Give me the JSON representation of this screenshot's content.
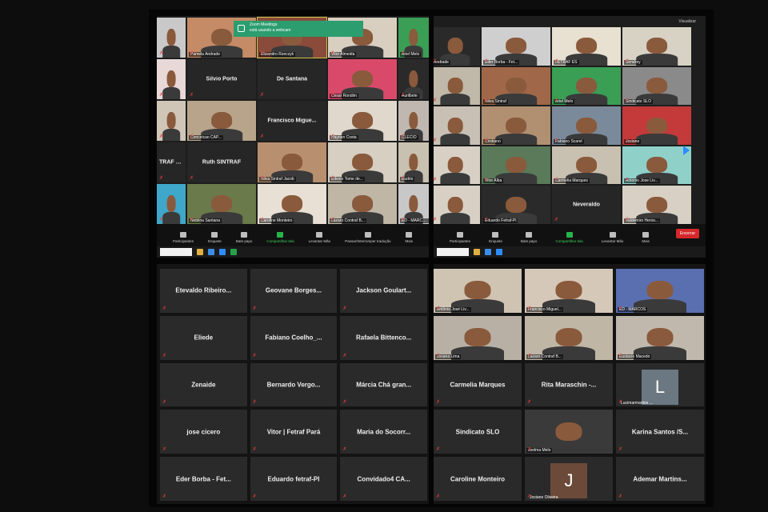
{
  "notification": {
    "title": "Zoom Meetings",
    "text": "está usando a webcam"
  },
  "view_button": "Visualizar",
  "tl": {
    "tiles": [
      {
        "t": "vid",
        "name": "",
        "c": "#c9c9c9"
      },
      {
        "t": "vid",
        "name": "Pamela Andrade",
        "c": "#c48b66"
      },
      {
        "t": "vid",
        "name": "Elizandro Rzeczyk",
        "c": "#8a4b3a",
        "hl": true
      },
      {
        "t": "vid",
        "name": "Vitor Almeida",
        "c": "#d8cfc0"
      },
      {
        "t": "vid",
        "name": "Ariel Melo",
        "c": "#3a9e55"
      },
      {
        "t": "vid",
        "name": "",
        "c": "#e8d8d8"
      },
      {
        "t": "name",
        "name": "Silvio Porto"
      },
      {
        "t": "name",
        "name": "De Santana"
      },
      {
        "t": "vid",
        "name": "Cesar Rondim",
        "c": "#d94a6a"
      },
      {
        "t": "vid",
        "name": "Aurilbete",
        "c": "#2a2a2a"
      },
      {
        "t": "vid",
        "name": "",
        "c": "#d0c6b8"
      },
      {
        "t": "vid",
        "name": "Conceicao CAP...",
        "c": "#b7a48a"
      },
      {
        "t": "name",
        "name": "Francisco Migue..."
      },
      {
        "t": "vid",
        "name": "Haynen Costa",
        "c": "#e0d8cc"
      },
      {
        "t": "vid",
        "name": "CLECIO",
        "c": "#c0b8b0"
      },
      {
        "t": "name",
        "name": "TRAF RN"
      },
      {
        "t": "name",
        "name": "Ruth SINTRAF"
      },
      {
        "t": "vid",
        "name": "Nilva Sintraf Jacob",
        "c": "#b89070"
      },
      {
        "t": "vid",
        "name": "Edesio Tome de...",
        "c": "#d6cfc2"
      },
      {
        "t": "vid",
        "name": "Eudrio",
        "c": "#c8c0b0"
      },
      {
        "t": "vid",
        "name": "",
        "c": "#3fa7c9"
      },
      {
        "t": "vid",
        "name": "Neblina Santana",
        "c": "#6a7a4a"
      },
      {
        "t": "vid",
        "name": "Caroline Monteiro",
        "c": "#e8e0d4"
      },
      {
        "t": "vid",
        "name": "Lazaro Contraf B...",
        "c": "#bfb6a6"
      },
      {
        "t": "vid",
        "name": "ED - MARCOS",
        "c": "#c8c8c8"
      }
    ],
    "toolbar": [
      "Participantes",
      "Enquete",
      "Bate papo",
      "Compartilhar tela",
      "Levantar Mão",
      "Passar/Interromper tradução",
      "Mais"
    ]
  },
  "tr": {
    "tiles": [
      {
        "t": "vid",
        "name": "Andrade",
        "c": "#2a2a2a"
      },
      {
        "t": "vid",
        "name": "Eder Borba - Fet...",
        "c": "#cfcfcf"
      },
      {
        "t": "vid",
        "name": "FETRAF ES",
        "c": "#e8e0d0"
      },
      {
        "t": "vid",
        "name": "Sendrey",
        "c": "#d8d2c4"
      },
      {
        "t": "vid",
        "name": "",
        "c": "#c0b8a8"
      },
      {
        "t": "vid",
        "name": "Nilva Sintraf",
        "c": "#a06848"
      },
      {
        "t": "vid",
        "name": "Ariel Melo",
        "c": "#3a9e55"
      },
      {
        "t": "vid",
        "name": "Sindicato SLO",
        "c": "#8a8a8a"
      },
      {
        "t": "vid",
        "name": "",
        "c": "#c8c0b4"
      },
      {
        "t": "vid",
        "name": "Cristiano",
        "c": "#b09070"
      },
      {
        "t": "vid",
        "name": "Fabiano Scarel",
        "c": "#7a8a9a"
      },
      {
        "t": "vid",
        "name": "Josiane",
        "c": "#c43a3a"
      },
      {
        "t": "vid",
        "name": "",
        "c": "#d8d0c4"
      },
      {
        "t": "vid",
        "name": "Vitor Alba",
        "c": "#5a7a5a"
      },
      {
        "t": "vid",
        "name": "Carmelia Marques",
        "c": "#c8c0b0"
      },
      {
        "t": "vid",
        "name": "Antonio Jose Liv...",
        "c": "#8fd1c9"
      },
      {
        "t": "vid",
        "name": "",
        "c": "#d8d0c4"
      },
      {
        "t": "vid",
        "name": "Eduardo Fetraf-Pi",
        "c": "#2a2a2a"
      },
      {
        "t": "name",
        "name": "Neveraldo"
      },
      {
        "t": "vid",
        "name": "Valdemiro Heros...",
        "c": "#d8d0c4"
      }
    ],
    "toolbar": [
      "Participantes",
      "Enquete",
      "Bate papo",
      "Compartilhar tela",
      "Levantar Mão",
      "Mais"
    ],
    "end_label": "Encerrar"
  },
  "bl": {
    "tiles": [
      "Etevaldo  Ribeiro...",
      "Geovane  Borges...",
      "Jackson  Goulart...",
      "Eliede",
      "Fabiano  Coelho_...",
      "Rafaela  Bittenco...",
      "Zenaide",
      "Bernardo  Vergo...",
      "Márcia  Chá  gran...",
      "jose cicero",
      "Vitor | Fetraf Pará",
      "Maria do  Socorr...",
      "Eder Borba  -  Fet...",
      "Eduardo  fetraf-PI",
      "Convidado4  CA..."
    ]
  },
  "br": {
    "tiles": [
      {
        "t": "vid",
        "name": "Antônio José Liv...",
        "c": "#cfc4b2"
      },
      {
        "t": "vid",
        "name": "Francisco Miguel...",
        "c": "#d6c8b8"
      },
      {
        "t": "vid",
        "name": "ED - MARCOS",
        "c": "#5a6fb0"
      },
      {
        "t": "vid",
        "name": "Josana Lima",
        "c": "#b8b0a4"
      },
      {
        "t": "vid",
        "name": "Lazaro Contraf B...",
        "c": "#bfb6a6"
      },
      {
        "t": "vid",
        "name": "Eustacio Macedo",
        "c": "#c0b8ac"
      },
      {
        "t": "name",
        "name": "Carmelia Marques"
      },
      {
        "t": "name",
        "name": "Rita  Maraschin  -..."
      },
      {
        "t": "av",
        "name": "Lucimarmartins ...",
        "letter": "L",
        "cls": ""
      },
      {
        "t": "name",
        "name": "Sindicato SLO"
      },
      {
        "t": "vid",
        "name": "Joelma Melo",
        "c": "#3a3a3a"
      },
      {
        "t": "name",
        "name": "Karina  Santos  /S..."
      },
      {
        "t": "name",
        "name": "Caroline Monteiro"
      },
      {
        "t": "av",
        "name": "Josiane Oliveira",
        "letter": "J",
        "cls": "brown"
      },
      {
        "t": "name",
        "name": "Ademar  Martins..."
      }
    ]
  }
}
